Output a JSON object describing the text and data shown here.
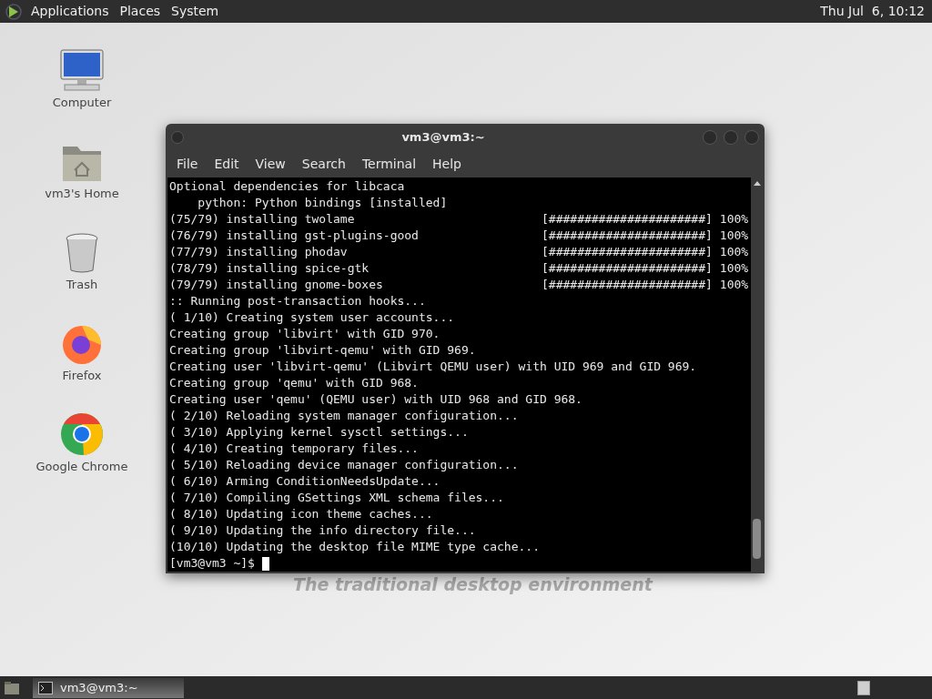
{
  "top_panel": {
    "menus": [
      "Applications",
      "Places",
      "System"
    ],
    "clock": "Thu Jul  6, 10:12"
  },
  "desktop_icons": [
    {
      "kind": "computer",
      "label": "Computer"
    },
    {
      "kind": "home",
      "label": "vm3's Home"
    },
    {
      "kind": "trash",
      "label": "Trash"
    },
    {
      "kind": "firefox",
      "label": "Firefox"
    },
    {
      "kind": "chrome",
      "label": "Google Chrome"
    }
  ],
  "wallpaper_text": "The traditional desktop environment",
  "window": {
    "title": "vm3@vm3:~",
    "menu": [
      "File",
      "Edit",
      "View",
      "Search",
      "Terminal",
      "Help"
    ],
    "lines": [
      {
        "kind": "text",
        "text": "Optional dependencies for libcaca"
      },
      {
        "kind": "text",
        "text": "    python: Python bindings [installed]"
      },
      {
        "kind": "progress",
        "text": "(75/79) installing twolame",
        "bar": "[######################]",
        "percent": "100%"
      },
      {
        "kind": "progress",
        "text": "(76/79) installing gst-plugins-good",
        "bar": "[######################]",
        "percent": "100%"
      },
      {
        "kind": "progress",
        "text": "(77/79) installing phodav",
        "bar": "[######################]",
        "percent": "100%"
      },
      {
        "kind": "progress",
        "text": "(78/79) installing spice-gtk",
        "bar": "[######################]",
        "percent": "100%"
      },
      {
        "kind": "progress",
        "text": "(79/79) installing gnome-boxes",
        "bar": "[######################]",
        "percent": "100%"
      },
      {
        "kind": "text",
        "text": ":: Running post-transaction hooks..."
      },
      {
        "kind": "text",
        "text": "( 1/10) Creating system user accounts..."
      },
      {
        "kind": "text",
        "text": "Creating group 'libvirt' with GID 970."
      },
      {
        "kind": "text",
        "text": "Creating group 'libvirt-qemu' with GID 969."
      },
      {
        "kind": "text",
        "text": "Creating user 'libvirt-qemu' (Libvirt QEMU user) with UID 969 and GID 969."
      },
      {
        "kind": "text",
        "text": "Creating group 'qemu' with GID 968."
      },
      {
        "kind": "text",
        "text": "Creating user 'qemu' (QEMU user) with UID 968 and GID 968."
      },
      {
        "kind": "text",
        "text": "( 2/10) Reloading system manager configuration..."
      },
      {
        "kind": "text",
        "text": "( 3/10) Applying kernel sysctl settings..."
      },
      {
        "kind": "text",
        "text": "( 4/10) Creating temporary files..."
      },
      {
        "kind": "text",
        "text": "( 5/10) Reloading device manager configuration..."
      },
      {
        "kind": "text",
        "text": "( 6/10) Arming ConditionNeedsUpdate..."
      },
      {
        "kind": "text",
        "text": "( 7/10) Compiling GSettings XML schema files..."
      },
      {
        "kind": "text",
        "text": "( 8/10) Updating icon theme caches..."
      },
      {
        "kind": "text",
        "text": "( 9/10) Updating the info directory file..."
      },
      {
        "kind": "text",
        "text": "(10/10) Updating the desktop file MIME type cache..."
      },
      {
        "kind": "prompt",
        "text": "[vm3@vm3 ~]$"
      }
    ]
  },
  "taskbar": {
    "tasks": [
      {
        "label": "vm3@vm3:~",
        "selected": true
      }
    ]
  }
}
